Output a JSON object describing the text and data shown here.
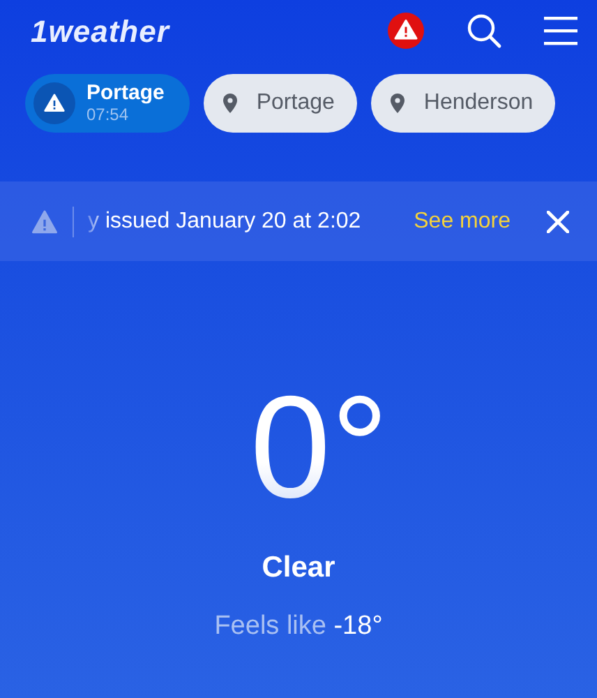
{
  "header": {
    "logo": "1weather",
    "alert_active": true
  },
  "locations": [
    {
      "kind": "alert",
      "name": "Portage",
      "time": "07:54",
      "selected": true
    },
    {
      "kind": "pin",
      "name": "Portage",
      "selected": false
    },
    {
      "kind": "pin",
      "name": "Henderson",
      "selected": false
    }
  ],
  "alert_banner": {
    "text": "y issued January 20 at 2:02",
    "link": "See more"
  },
  "current": {
    "temperature": "0°",
    "condition": "Clear",
    "feels_like": "Feels like **-18°**"
  }
}
